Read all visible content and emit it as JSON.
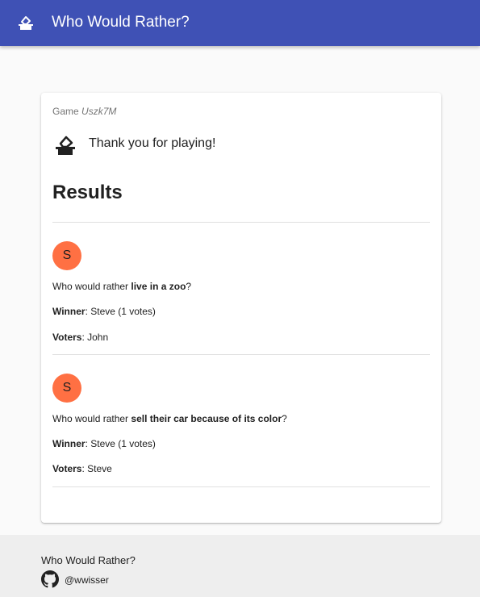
{
  "appbar": {
    "title": "Who Would Rather?",
    "logo_icon": "ballot-box-icon",
    "color": "#3f51b5"
  },
  "card": {
    "game_label": "Game",
    "game_code": "Uszk7M",
    "thanks_icon": "ballot-box-icon",
    "thanks_text": "Thank you for playing!",
    "results_heading": "Results",
    "results": [
      {
        "avatar_letter": "S",
        "avatar_color": "#ff7043",
        "question_prefix": "Who would rather",
        "question_action": "live in a zoo",
        "question_suffix": "?",
        "winner_label": "Winner",
        "winner_value": ": Steve (1 votes)",
        "voters_label": "Voters",
        "voters_value": ": John"
      },
      {
        "avatar_letter": "S",
        "avatar_color": "#ff7043",
        "question_prefix": "Who would rather",
        "question_action": "sell their car because of its color",
        "question_suffix": "?",
        "winner_label": "Winner",
        "winner_value": ": Steve (1 votes)",
        "voters_label": "Voters",
        "voters_value": ": Steve"
      }
    ]
  },
  "footer": {
    "title": "Who Would Rather?",
    "github_icon": "github-icon",
    "handle": "@wwisser"
  }
}
